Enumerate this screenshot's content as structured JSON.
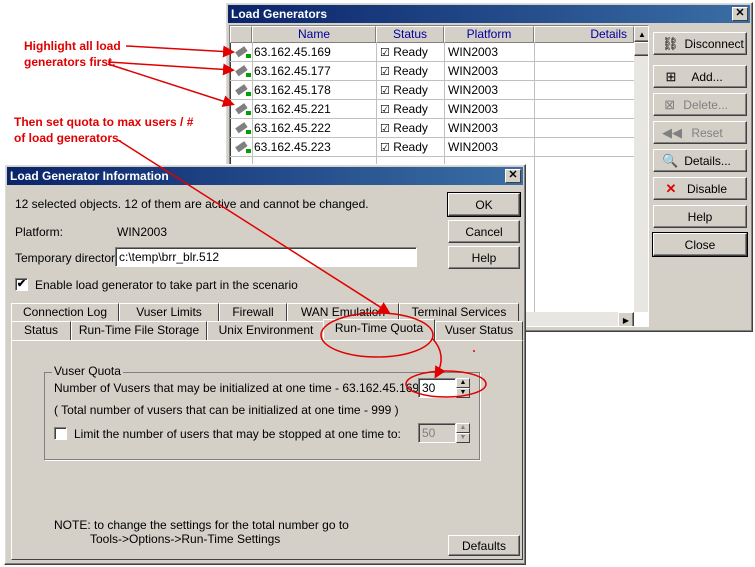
{
  "colors": {
    "title_bar": "#0a246a",
    "annotation": "#e00000",
    "header_text": "#00009c"
  },
  "load_generators": {
    "title": "Load Generators",
    "close_glyph": "✕",
    "columns": [
      "Name",
      "Status",
      "Platform",
      "Details"
    ],
    "rows": [
      {
        "name": "63.162.45.169",
        "status": "Ready",
        "platform": "WIN2003"
      },
      {
        "name": "63.162.45.177",
        "status": "Ready",
        "platform": "WIN2003"
      },
      {
        "name": "63.162.45.178",
        "status": "Ready",
        "platform": "WIN2003"
      },
      {
        "name": "63.162.45.221",
        "status": "Ready",
        "platform": "WIN2003"
      },
      {
        "name": "63.162.45.222",
        "status": "Ready",
        "platform": "WIN2003"
      },
      {
        "name": "63.162.45.223",
        "status": "Ready",
        "platform": "WIN2003"
      }
    ],
    "buttons": {
      "disconnect": {
        "label": "Disconnect",
        "icon": "disconnect-icon"
      },
      "add": {
        "label": "Add...",
        "icon": "add-generator-icon"
      },
      "delete": {
        "label": "Delete...",
        "icon": "delete-generator-icon"
      },
      "reset": {
        "label": "Reset",
        "icon": "rewind-icon"
      },
      "details": {
        "label": "Details...",
        "icon": "details-icon"
      },
      "disable": {
        "label": "Disable",
        "icon": "red-x-icon"
      },
      "help": {
        "label": "Help"
      },
      "close": {
        "label": "Close"
      }
    }
  },
  "info_dialog": {
    "title": "Load Generator Information",
    "close_glyph": "✕",
    "summary": "12 selected objects. 12 of them are active and cannot be changed.",
    "platform_label": "Platform:",
    "platform_value": "WIN2003",
    "temp_dir_label": "Temporary directory:",
    "temp_dir_value": "c:\\temp\\brr_blr.512",
    "enable_label": "Enable load generator to take part in the scenario",
    "enable_checked": true,
    "ok_label": "OK",
    "cancel_label": "Cancel",
    "help_label": "Help",
    "tabs_back": [
      "Connection Log",
      "Vuser Limits",
      "Firewall",
      "WAN Emulation",
      "Terminal Services"
    ],
    "tabs_front": [
      "Status",
      "Run-Time File Storage",
      "Unix Environment",
      "Run-Time Quota",
      "Vuser Status"
    ],
    "active_tab": "Run-Time Quota",
    "quota": {
      "group_label": "Vuser Quota",
      "init_label": "Number of Vusers that may be initialized at one time - 63.162.45.169",
      "init_value": "30",
      "total_label": "( Total number of vusers that can be initialized at one time - 999 )",
      "limit_label": "Limit the number of users that may be stopped at one time to:",
      "limit_checked": false,
      "limit_value": "50"
    },
    "note_line1": "NOTE: to change the settings for the total number go to",
    "note_line2": "Tools->Options->Run-Time Settings",
    "defaults_label": "Defaults"
  },
  "annotations": {
    "note1_line1": "Highlight all load",
    "note1_line2": "generators first.",
    "note2_line1": "Then set quota to max users / #",
    "note2_line2": "of load generators."
  }
}
